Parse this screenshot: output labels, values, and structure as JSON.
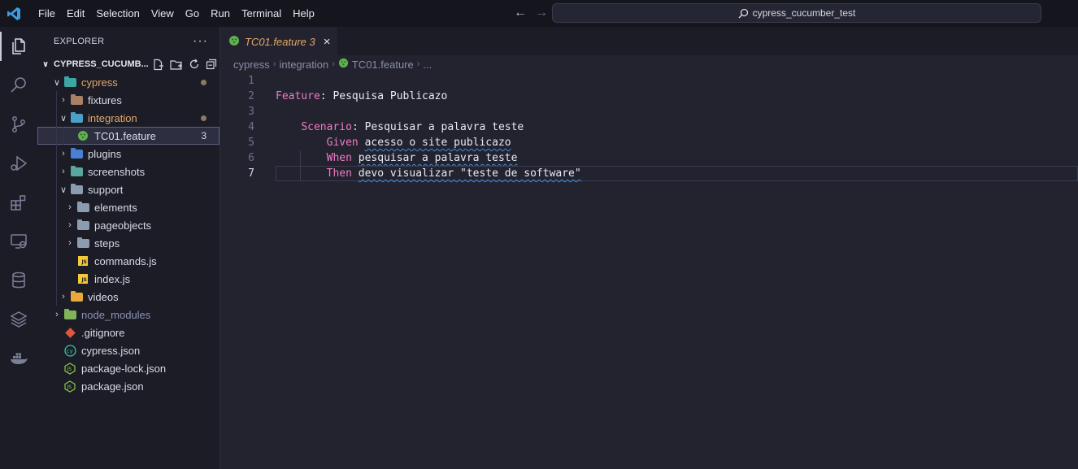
{
  "titlebar": {
    "menu": [
      "File",
      "Edit",
      "Selection",
      "View",
      "Go",
      "Run",
      "Terminal",
      "Help"
    ],
    "search_text": "cypress_cucumber_test",
    "back_icon": "arrow-left-icon",
    "forward_icon": "arrow-right-icon"
  },
  "activitybar": {
    "items": [
      "explorer-icon",
      "search-icon",
      "source-control-icon",
      "run-debug-icon",
      "extensions-icon",
      "remote-explorer-icon",
      "database-icon",
      "layers-icon",
      "docker-icon"
    ]
  },
  "sidebar": {
    "title": "EXPLORER",
    "more": "···",
    "project": "CYPRESS_CUCUMB...",
    "tree": [
      {
        "label": "cypress",
        "type": "folder",
        "color": "#3aa7a3"
      },
      {
        "label": "fixtures",
        "type": "folder",
        "color": "#a98063"
      },
      {
        "label": "integration",
        "type": "folder",
        "color": "#4aa0c8"
      },
      {
        "label": "TC01.feature",
        "type": "feature",
        "badge": "3"
      },
      {
        "label": "plugins",
        "type": "folder",
        "color": "#4a7fd6"
      },
      {
        "label": "screenshots",
        "type": "folder",
        "color": "#5aa7a0"
      },
      {
        "label": "support",
        "type": "folder",
        "color": "#8b9cb0"
      },
      {
        "label": "elements",
        "type": "folder",
        "color": "#8b9cb0"
      },
      {
        "label": "pageobjects",
        "type": "folder",
        "color": "#8b9cb0"
      },
      {
        "label": "steps",
        "type": "folder",
        "color": "#8b9cb0"
      },
      {
        "label": "commands.js",
        "type": "js"
      },
      {
        "label": "index.js",
        "type": "js"
      },
      {
        "label": "videos",
        "type": "folder",
        "color": "#e8a93a"
      },
      {
        "label": "node_modules",
        "type": "folder",
        "color": "#7fb45c"
      },
      {
        "label": ".gitignore",
        "type": "git"
      },
      {
        "label": "cypress.json",
        "type": "cy"
      },
      {
        "label": "package-lock.json",
        "type": "node"
      },
      {
        "label": "package.json",
        "type": "node"
      }
    ]
  },
  "editor": {
    "tab_title": "TC01.feature",
    "tab_badge": "3",
    "close": "×",
    "breadcrumb": [
      "cypress",
      "integration",
      "TC01.feature",
      "..."
    ],
    "lines": [
      {
        "n": "1",
        "kw": "",
        "rest": ""
      },
      {
        "n": "2",
        "kw": "Feature",
        "rest": ": Pesquisa Publicazo"
      },
      {
        "n": "3",
        "kw": "",
        "rest": ""
      },
      {
        "n": "4",
        "kw": "Scenario",
        "rest": ": Pesquisar a palavra teste"
      },
      {
        "n": "5",
        "kw": "Given",
        "rest": "acesso o site publicazo"
      },
      {
        "n": "6",
        "kw": "When",
        "rest": "pesquisar a palavra teste"
      },
      {
        "n": "7",
        "kw": "Then",
        "rest": "devo visualizar \"teste de software\""
      }
    ]
  },
  "colors": {
    "keyword": "#ee7ac4",
    "modified": "#e2a769",
    "background": "#22232f"
  }
}
